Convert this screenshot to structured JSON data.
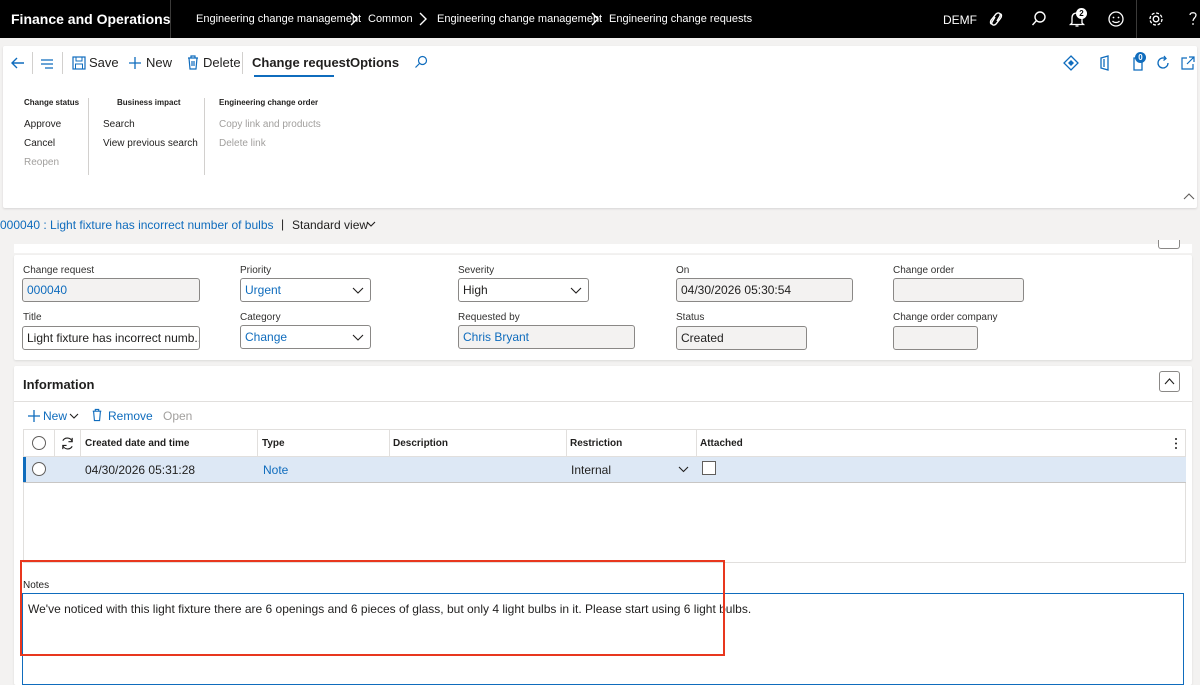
{
  "app": {
    "title": "Finance and Operations",
    "company": "DEMF",
    "notification_count": "2"
  },
  "breadcrumbs": [
    "Engineering change management",
    "Common",
    "Engineering change management",
    "Engineering change requests"
  ],
  "toolbar": {
    "save": "Save",
    "new": "New",
    "delete": "Delete",
    "tab_change_request": "Change request",
    "tab_options": "Options",
    "sync_badge": "0"
  },
  "ribbon": {
    "change_status": {
      "title": "Change status",
      "items": [
        "Approve",
        "Cancel",
        "Reopen"
      ]
    },
    "business_impact": {
      "title": "Business impact",
      "items": [
        "Search",
        "View previous search"
      ]
    },
    "engineering_change_order": {
      "title": "Engineering change order",
      "items": [
        "Copy link and products",
        "Delete link"
      ]
    }
  },
  "record": {
    "caption": "000040 : Light fixture has incorrect number of bulbs",
    "separator": "|",
    "view": "Standard view"
  },
  "header": {
    "change_request": {
      "label": "Change request",
      "value": "000040"
    },
    "title": {
      "label": "Title",
      "value": "Light fixture has incorrect numb..."
    },
    "priority": {
      "label": "Priority",
      "value": "Urgent"
    },
    "category": {
      "label": "Category",
      "value": "Change"
    },
    "severity": {
      "label": "Severity",
      "value": "High"
    },
    "requested_by": {
      "label": "Requested by",
      "value": "Chris Bryant"
    },
    "on": {
      "label": "On",
      "value": "04/30/2026 05:30:54"
    },
    "status": {
      "label": "Status",
      "value": "Created"
    },
    "change_order": {
      "label": "Change order",
      "value": ""
    },
    "change_order_company": {
      "label": "Change order company",
      "value": ""
    }
  },
  "information": {
    "title": "Information",
    "toolbar": {
      "new": "New",
      "remove": "Remove",
      "open": "Open"
    },
    "columns": [
      "Created date and time",
      "Type",
      "Description",
      "Restriction",
      "Attached"
    ],
    "rows": [
      {
        "created": "04/30/2026 05:31:28",
        "type": "Note",
        "description": "",
        "restriction": "Internal",
        "attached": false
      }
    ],
    "notes_label": "Notes",
    "notes_text": "We've noticed with this light fixture there are 6 openings and 6 pieces of glass, but only 4 light bulbs in it. Please start using 6 light bulbs."
  },
  "colors": {
    "accent": "#0f6cbd",
    "highlight": "#e8371e",
    "topbar": "#000000",
    "selected_row": "#dde8f5"
  }
}
